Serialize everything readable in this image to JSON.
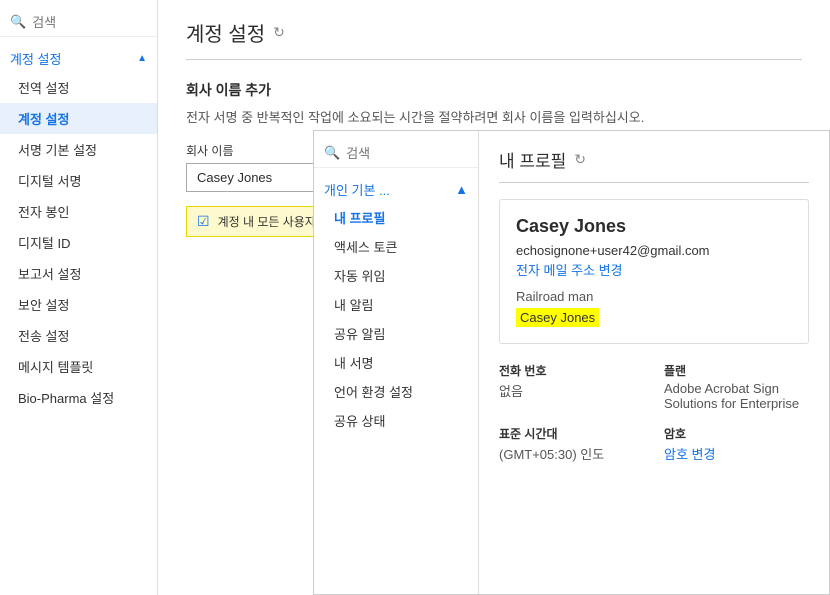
{
  "sidebar": {
    "search_placeholder": "검색",
    "groups": [
      {
        "label": "계정 설정",
        "expanded": true,
        "items": [
          {
            "label": "전역 설정",
            "active": false
          },
          {
            "label": "계정 설정",
            "active": true
          },
          {
            "label": "서명 기본 설정",
            "active": false
          },
          {
            "label": "디지털 서명",
            "active": false
          },
          {
            "label": "전자 봉인",
            "active": false
          },
          {
            "label": "디지털 ID",
            "active": false
          },
          {
            "label": "보고서 설정",
            "active": false
          },
          {
            "label": "보안 설정",
            "active": false
          },
          {
            "label": "전송 설정",
            "active": false
          },
          {
            "label": "메시지 템플릿",
            "active": false
          },
          {
            "label": "Bio-Pharma 설정",
            "active": false
          }
        ]
      }
    ]
  },
  "main": {
    "page_title": "계정 설정",
    "refresh_icon": "↻",
    "section_label": "회사 이름 추가",
    "section_desc": "전자 서명 중 반복적인 작업에 소요되는 시간을 절약하려면 회사 이름을 입력하십시오.",
    "field_label": "회사 이름",
    "field_value": "Casey Jones",
    "checkbox_label": "계정 내 모든 사용자의 회사 이름을 입력하십시오."
  },
  "inner_sidebar": {
    "search_placeholder": "검색",
    "group_label": "개인 기본 ...",
    "items": [
      {
        "label": "내 프로필",
        "active": true
      },
      {
        "label": "액세스 토큰",
        "active": false
      },
      {
        "label": "자동 위임",
        "active": false
      },
      {
        "label": "내 알림",
        "active": false
      },
      {
        "label": "공유 알림",
        "active": false
      },
      {
        "label": "내 서명",
        "active": false
      },
      {
        "label": "언어 환경 설정",
        "active": false
      },
      {
        "label": "공유 상태",
        "active": false
      }
    ]
  },
  "profile": {
    "title": "내 프로필",
    "refresh_icon": "↻",
    "name": "Casey Jones",
    "email": "echosignone+user42@gmail.com",
    "email_change_label": "전자 메일 주소 변경",
    "role": "Railroad man",
    "company_highlight": "Casey Jones",
    "phone_label": "전화 번호",
    "phone_value": "없음",
    "plan_label": "플랜",
    "plan_value": "Adobe Acrobat Sign Solutions for Enterprise",
    "timezone_label": "표준 시간대",
    "timezone_value": "(GMT+05:30) 인도",
    "password_label": "암호",
    "password_change_label": "암호 변경"
  }
}
